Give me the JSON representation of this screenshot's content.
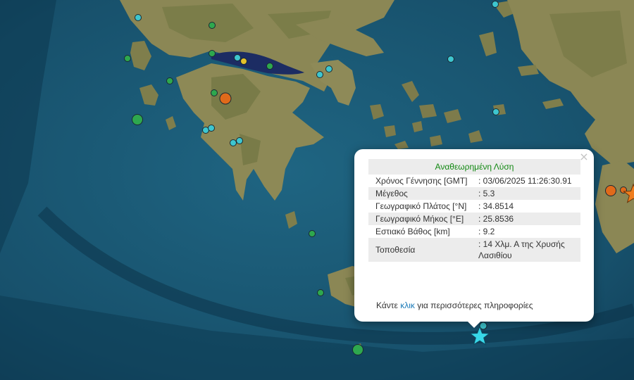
{
  "popup": {
    "close_symbol": "×",
    "title": "Αναθεωρημένη Λύση",
    "rows": [
      {
        "label": "Χρόνος Γέννησης [GMT]",
        "value": ": 03/06/2025 11:26:30.91"
      },
      {
        "label": "Μέγεθος",
        "value": ": 5.3"
      },
      {
        "label": "Γεωγραφικό Πλάτος [°N]",
        "value": ": 34.8514"
      },
      {
        "label": "Γεωγραφικό Μήκος [°E]",
        "value": ": 25.8536"
      },
      {
        "label": "Εστιακό Βάθος [km]",
        "value": ": 9.2"
      },
      {
        "label": "Τοποθεσία",
        "value": ": 14 Χλμ. Α της Χρυσής Λασιθίου"
      }
    ],
    "footer_prefix": "Κάντε ",
    "footer_link": "κλικ",
    "footer_suffix": " για περισσότερες πληροφορίες"
  },
  "colors": {
    "sea": "#1b5a78",
    "deep_sea": "#0e3e57",
    "land": "#8a8654",
    "gulf": "#1a2a5e",
    "marker_cyan": "#3ec6cf",
    "marker_green": "#2ea84e",
    "marker_orange": "#e06a1a",
    "marker_yellow": "#e5c22a",
    "star_cyan": "#38d8e8",
    "star_orange": "#ef7d1e"
  }
}
